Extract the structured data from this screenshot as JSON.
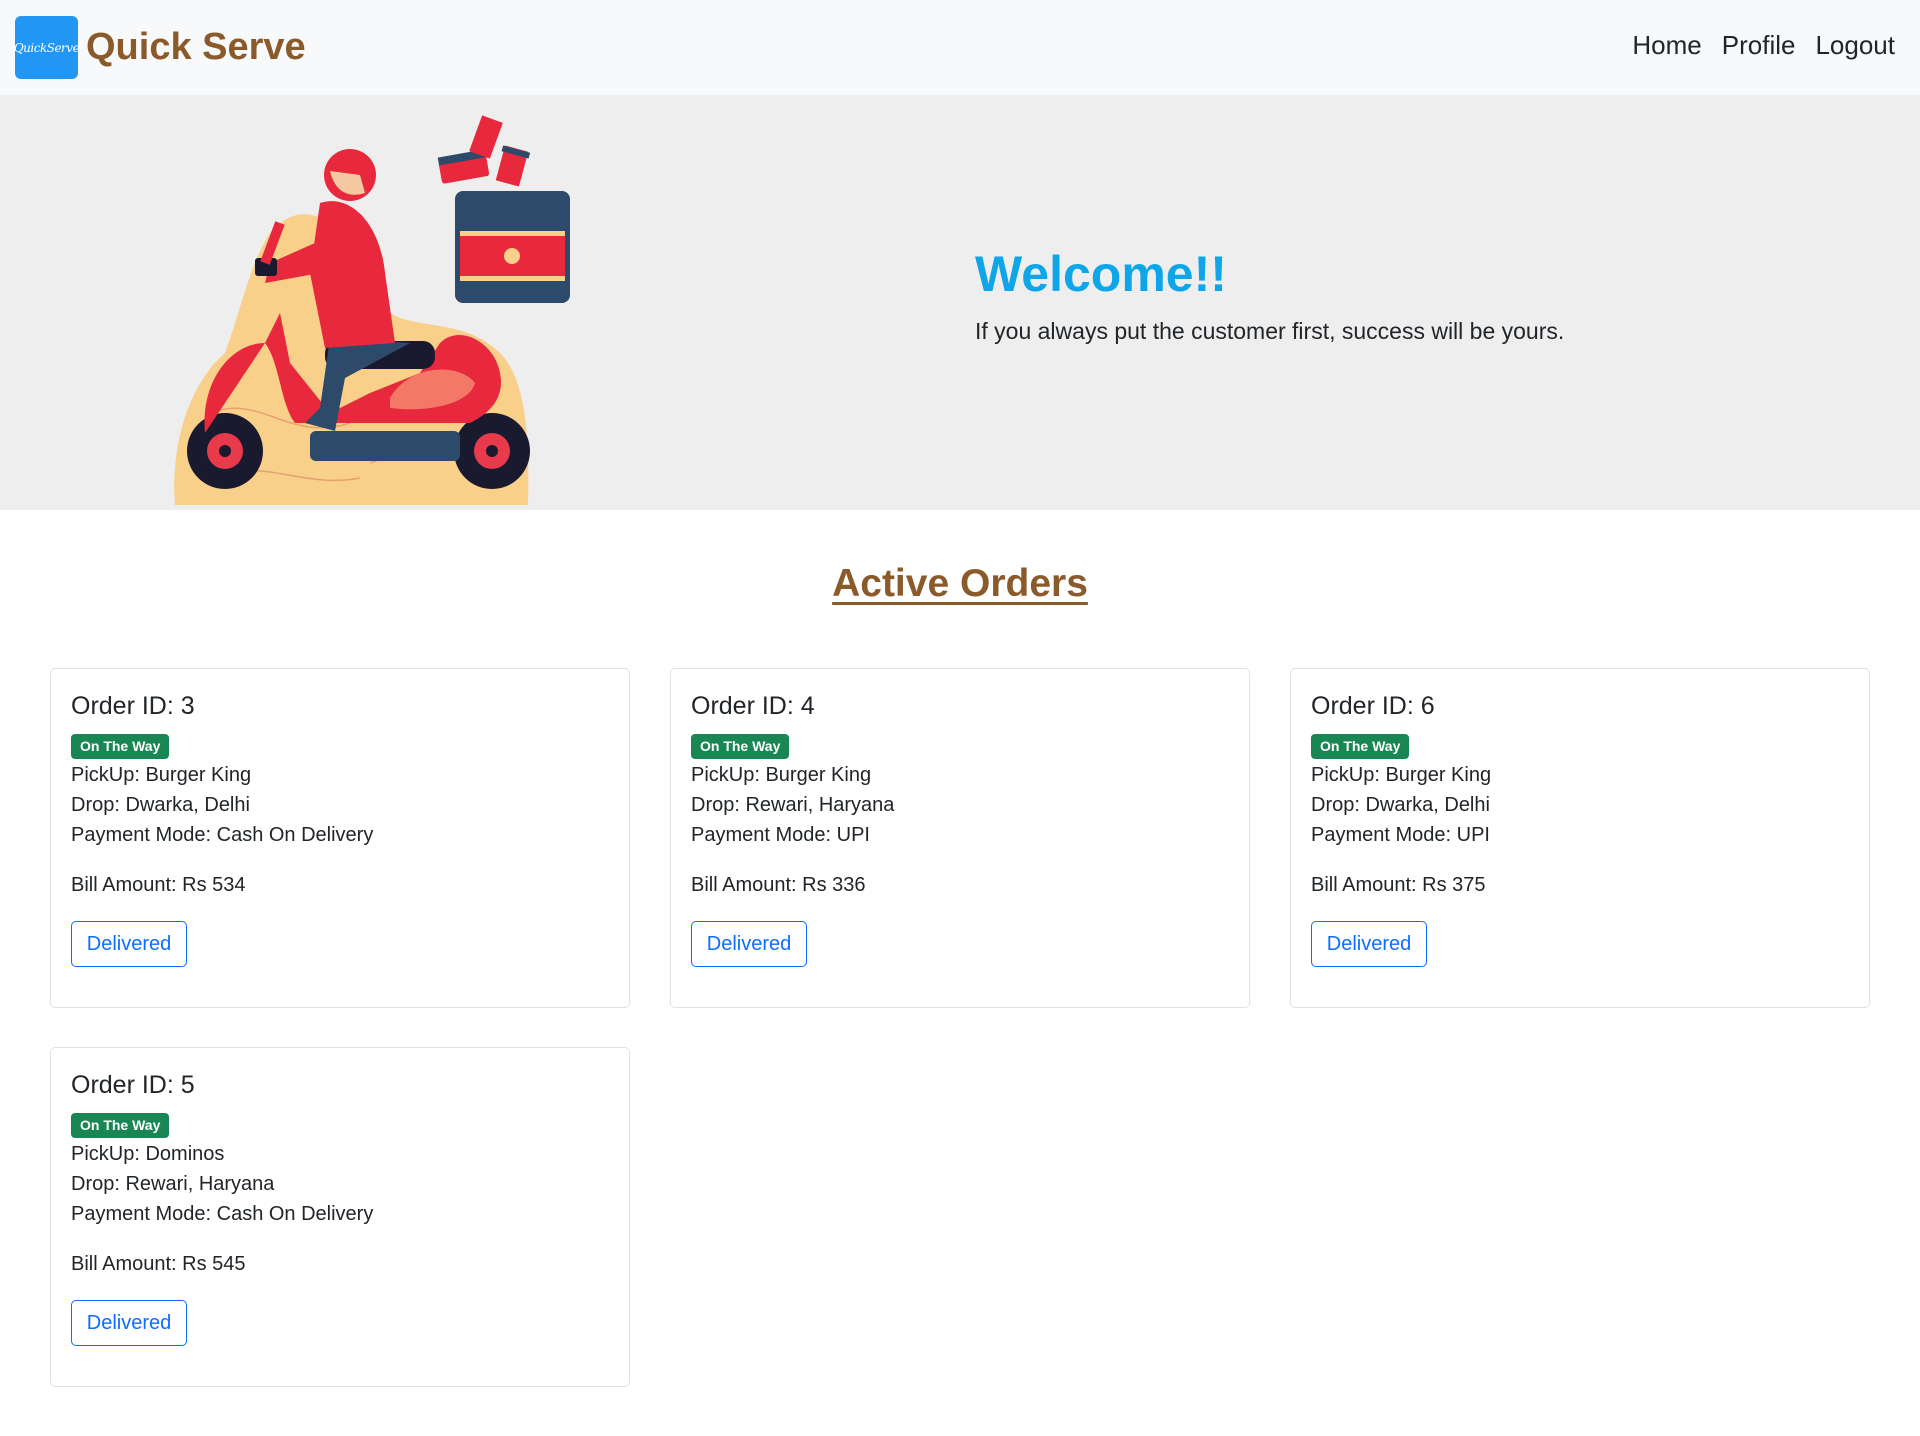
{
  "navbar": {
    "logo_text": "QuickServe",
    "brand": "Quick Serve",
    "links": [
      "Home",
      "Profile",
      "Logout"
    ]
  },
  "hero": {
    "title": "Welcome!!",
    "subtitle": "If you always put the customer first, success will be yours."
  },
  "section_title": "Active Orders",
  "orders": [
    {
      "title": "Order ID: 3",
      "status": "On The Way",
      "pickup": "PickUp: Burger King",
      "drop": "Drop: Dwarka, Delhi",
      "payment": "Payment Mode: Cash On Delivery",
      "bill": "Bill Amount: Rs 534",
      "button": "Delivered"
    },
    {
      "title": "Order ID: 4",
      "status": "On The Way",
      "pickup": "PickUp: Burger King",
      "drop": "Drop: Rewari, Haryana",
      "payment": "Payment Mode: UPI",
      "bill": "Bill Amount: Rs 336",
      "button": "Delivered"
    },
    {
      "title": "Order ID: 6",
      "status": "On The Way",
      "pickup": "PickUp: Burger King",
      "drop": "Drop: Dwarka, Delhi",
      "payment": "Payment Mode: UPI",
      "bill": "Bill Amount: Rs 375",
      "button": "Delivered"
    },
    {
      "title": "Order ID: 5",
      "status": "On The Way",
      "pickup": "PickUp: Dominos",
      "drop": "Drop: Rewari, Haryana",
      "payment": "Payment Mode: Cash On Delivery",
      "bill": "Bill Amount: Rs 545",
      "button": "Delivered"
    }
  ],
  "colors": {
    "brand": "#8b5a2b",
    "welcome": "#0ea5e9",
    "status_badge": "#198754",
    "button": "#0d6efd",
    "logo_bg": "#2196f3"
  }
}
